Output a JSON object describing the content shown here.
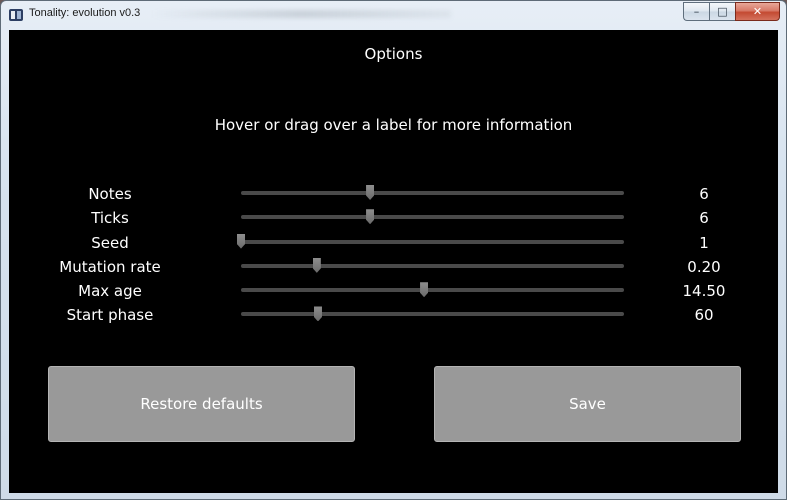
{
  "window": {
    "title": "Tonality: evolution v0.3",
    "caption": {
      "minimize": "–",
      "maximize": "□",
      "close": "✕"
    }
  },
  "options": {
    "title": "Options",
    "hint": "Hover or drag over a label for more information",
    "settings": [
      {
        "label": "Notes",
        "value": "6",
        "fraction": 0.337
      },
      {
        "label": "Ticks",
        "value": "6",
        "fraction": 0.337
      },
      {
        "label": "Seed",
        "value": "1",
        "fraction": 0.0
      },
      {
        "label": "Mutation rate",
        "value": "0.20",
        "fraction": 0.198
      },
      {
        "label": "Max age",
        "value": "14.50",
        "fraction": 0.478
      },
      {
        "label": "Start phase",
        "value": "60",
        "fraction": 0.201
      }
    ]
  },
  "buttons": {
    "restore": "Restore defaults",
    "save": "Save"
  },
  "colors": {
    "background": "#000000",
    "text": "#ffffff",
    "button": "#999999",
    "track": "#4a4a4a",
    "thumb": "#7a7a7a"
  }
}
